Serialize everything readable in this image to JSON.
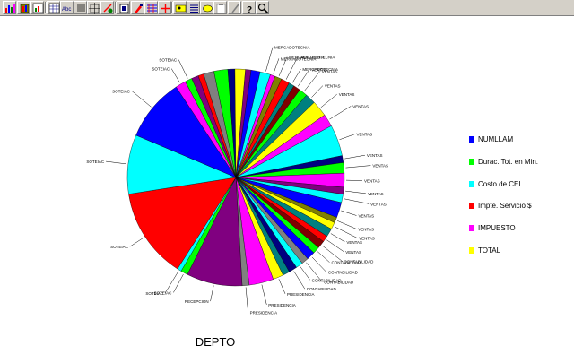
{
  "toolbar": {
    "buttons": [
      {
        "name": "bar-chart-icon"
      },
      {
        "name": "3d-bar-chart-icon"
      },
      {
        "name": "grid-chart-icon"
      },
      {
        "name": "data-table-icon"
      },
      {
        "name": "abc-labels-icon"
      },
      {
        "name": "list-view-icon"
      },
      {
        "name": "crosshair-grid-icon"
      },
      {
        "name": "tools-icon"
      },
      {
        "name": "select-box-icon"
      },
      {
        "name": "paint-tool-icon"
      },
      {
        "name": "pattern-icon"
      },
      {
        "name": "add-icon"
      },
      {
        "name": "image-icon"
      },
      {
        "name": "list-lines-icon"
      },
      {
        "name": "label-tag-icon"
      },
      {
        "name": "clipboard-icon"
      },
      {
        "name": "pencil-icon"
      },
      {
        "name": "help-icon"
      },
      {
        "name": "zoom-icon"
      }
    ]
  },
  "colors": {
    "blue": "#0000ff",
    "cyan": "#00ffff",
    "red": "#ff0000",
    "magenta": "#ff00ff",
    "purple": "#800080",
    "green": "#00ff00",
    "yellow": "#ffff00",
    "navy": "#000080",
    "teal": "#008080",
    "olive": "#808000",
    "gray": "#808080",
    "darkred": "#800000"
  },
  "chart_data": {
    "type": "pie",
    "title": "DEPTO",
    "legend": [
      {
        "label": "NUMLLAM",
        "color": "#0000ff"
      },
      {
        "label": "Durac. Tot. en Min.",
        "color": "#00ff00"
      },
      {
        "label": "Costo de CEL.",
        "color": "#00ffff"
      },
      {
        "label": "Impte. Servicio $",
        "color": "#ff0000"
      },
      {
        "label": "IMPUESTO",
        "color": "#ff00ff"
      },
      {
        "label": "TOTAL",
        "color": "#ffff00"
      }
    ],
    "legend_position": "right",
    "slices": [
      {
        "value": 1.0,
        "color": "#800080",
        "label": ""
      },
      {
        "value": 0.8,
        "color": "#ff0000",
        "label": ""
      },
      {
        "value": 1.5,
        "color": "#808080",
        "label": ""
      },
      {
        "value": 2.0,
        "color": "#00ff00",
        "label": ""
      },
      {
        "value": 1.0,
        "color": "#000080",
        "label": ""
      },
      {
        "value": 1.5,
        "color": "#ffff00",
        "label": ""
      },
      {
        "value": 0.8,
        "color": "#800080",
        "label": ""
      },
      {
        "value": 1.3,
        "color": "#0000ff",
        "label": ""
      },
      {
        "value": 1.5,
        "color": "#00ffff",
        "label": "MERCADOTECNIA"
      },
      {
        "value": 0.7,
        "color": "#ff00ff",
        "label": "MERCADOTECNIA"
      },
      {
        "value": 1.0,
        "color": "#808000",
        "label": "MERCADOTECNIA"
      },
      {
        "value": 1.2,
        "color": "#ff0000",
        "label": "MERCADOTECNIA"
      },
      {
        "value": 0.8,
        "color": "#008080",
        "label": "MERCADOTECNIA"
      },
      {
        "value": 1.0,
        "color": "#800000",
        "label": "VENTAS"
      },
      {
        "value": 1.2,
        "color": "#00ff00",
        "label": "VENTAS"
      },
      {
        "value": 1.5,
        "color": "#008080",
        "label": "VENTAS"
      },
      {
        "value": 2.3,
        "color": "#ffff00",
        "label": "VENTAS"
      },
      {
        "value": 1.8,
        "color": "#ff00ff",
        "label": "VENTAS"
      },
      {
        "value": 4.5,
        "color": "#00ffff",
        "label": "VENTAS"
      },
      {
        "value": 1.0,
        "color": "#000080",
        "label": "VENTAS"
      },
      {
        "value": 1.5,
        "color": "#00ff00",
        "label": "VENTAS"
      },
      {
        "value": 2.0,
        "color": "#ff00ff",
        "label": "VENTAS"
      },
      {
        "value": 1.0,
        "color": "#800080",
        "label": "VENTAS"
      },
      {
        "value": 1.2,
        "color": "#00ffff",
        "label": "VENTAS"
      },
      {
        "value": 2.2,
        "color": "#0000ff",
        "label": "VENTAS"
      },
      {
        "value": 0.8,
        "color": "#808000",
        "label": "VENTAS"
      },
      {
        "value": 1.0,
        "color": "#ffff00",
        "label": "VENTAS"
      },
      {
        "value": 1.2,
        "color": "#008080",
        "label": "VENTAS"
      },
      {
        "value": 0.9,
        "color": "#ff0000",
        "label": "VENTAS"
      },
      {
        "value": 1.1,
        "color": "#800000",
        "label": "CONTABILIDAD"
      },
      {
        "value": 1.0,
        "color": "#00ff00",
        "label": "CONTABILIDAD"
      },
      {
        "value": 1.2,
        "color": "#0000ff",
        "label": "CONTABILIDAD"
      },
      {
        "value": 1.0,
        "color": "#808080",
        "label": "CONTABILIDAD"
      },
      {
        "value": 1.0,
        "color": "#00ffff",
        "label": "CONTABILIDAD"
      },
      {
        "value": 1.2,
        "color": "#000080",
        "label": "CONTABILIDAD"
      },
      {
        "value": 1.0,
        "color": "#008080",
        "label": ""
      },
      {
        "value": 1.5,
        "color": "#ffff00",
        "label": "PRESIDENCIA"
      },
      {
        "value": 3.5,
        "color": "#ff00ff",
        "label": "PRESIDENCIA"
      },
      {
        "value": 1.0,
        "color": "#808080",
        "label": "PRESIDENCIA"
      },
      {
        "value": 8.0,
        "color": "#800080",
        "label": "RECEPCION"
      },
      {
        "value": 1.0,
        "color": "#00ff00",
        "label": "SOTEIAC"
      },
      {
        "value": 0.6,
        "color": "#00ffff",
        "label": "SOTEIAC"
      },
      {
        "value": 13.0,
        "color": "#ff0000",
        "label": "SOTEIAC"
      },
      {
        "value": 8.5,
        "color": "#00ffff",
        "label": "SOTEIAC"
      },
      {
        "value": 9.0,
        "color": "#0000ff",
        "label": "SOTEIAC"
      },
      {
        "value": 1.5,
        "color": "#ff00ff",
        "label": "SOTEIAC"
      },
      {
        "value": 1.0,
        "color": "#00ff00",
        "label": "SOTEIAC"
      }
    ]
  }
}
